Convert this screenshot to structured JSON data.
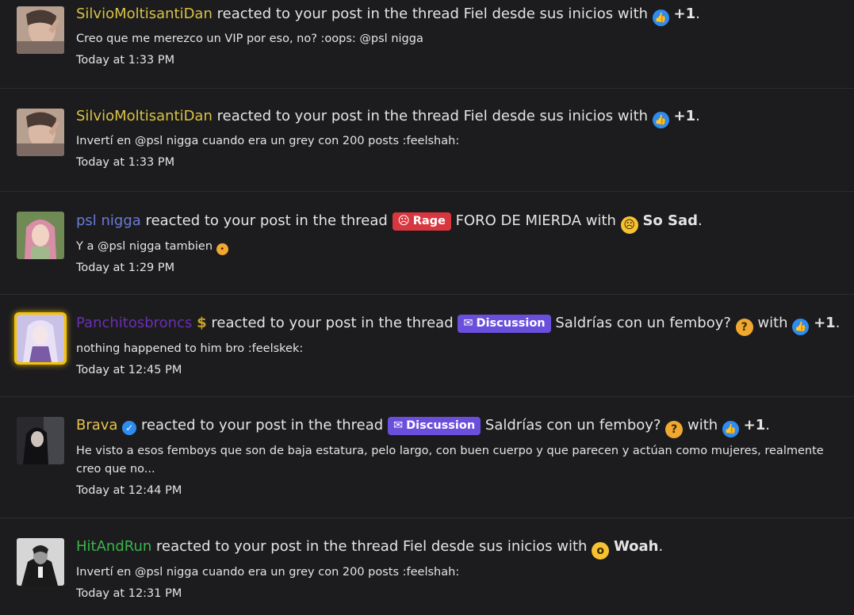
{
  "colors": {
    "user_yellow": "#d9c244",
    "user_blue": "#6b7bd8",
    "user_purple": "#7a36c7",
    "user_gold": "#e8c34a",
    "user_green": "#3bb54a",
    "like_blue": "#2e8cf0",
    "rage_red": "#d9373f",
    "discussion_purple": "#6a4fdc"
  },
  "notifications": [
    {
      "user": "SilvioMoltisantiDan",
      "pre": "reacted to your post in the thread",
      "thread": "Fiel desde sus inicios",
      "with": "with",
      "reaction_icon": "like-icon",
      "reaction": "+1",
      "excerpt": "Creo que me merezco un VIP por eso, no? :oops: @psl nigga",
      "time": "Today at 1:33 PM"
    },
    {
      "user": "SilvioMoltisantiDan",
      "pre": "reacted to your post in the thread",
      "thread": "Fiel desde sus inicios",
      "with": "with",
      "reaction_icon": "like-icon",
      "reaction": "+1",
      "excerpt": "Invertí en @psl nigga cuando era un grey con 200 posts :feelshah:",
      "time": "Today at 1:33 PM"
    },
    {
      "user": "psl nigga",
      "pre": "reacted to your post in the thread",
      "prefix_label": "Rage",
      "thread": "FORO DE MIERDA",
      "with": "with",
      "reaction_icon": "sad-face-icon",
      "reaction": "So Sad",
      "excerpt": "Y a @psl nigga tambien",
      "time": "Today at 1:29 PM"
    },
    {
      "user": "Panchitosbroncs",
      "user_badge": "$",
      "pre": "reacted to your post in the thread",
      "prefix_label": "Discussion",
      "thread": "Saldrías con un femboy?",
      "with": "with",
      "reaction_icon": "like-icon",
      "reaction": "+1",
      "excerpt": "nothing happened to him bro :feelskek:",
      "time": "Today at 12:45 PM"
    },
    {
      "user": "Brava",
      "pre": "reacted to your post in the thread",
      "prefix_label": "Discussion",
      "thread": "Saldrías con un femboy?",
      "with": "with",
      "reaction_icon": "like-icon",
      "reaction": "+1",
      "excerpt": "He visto a esos femboys que son de baja estatura, pelo largo, con buen cuerpo y que parecen y actúan como mujeres, realmente creo que no...",
      "time": "Today at 12:44 PM"
    },
    {
      "user": "HitAndRun",
      "pre": "reacted to your post in the thread",
      "thread": "Fiel desde sus inicios",
      "with": "with",
      "reaction_icon": "wow-face-icon",
      "reaction": "Woah",
      "excerpt": "Invertí en @psl nigga cuando era un grey con 200 posts :feelshah:",
      "time": "Today at 12:31 PM"
    }
  ]
}
